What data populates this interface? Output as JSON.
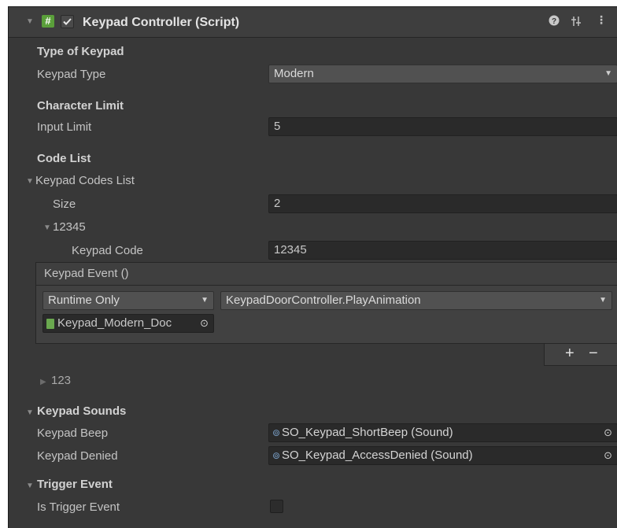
{
  "component": {
    "title": "Keypad Controller (Script)",
    "enabled": true
  },
  "sections": {
    "type_of_keypad": "Type of Keypad",
    "character_limit": "Character Limit",
    "code_list": "Code List"
  },
  "fields": {
    "keypad_type_label": "Keypad Type",
    "keypad_type_value": "Modern",
    "input_limit_label": "Input Limit",
    "input_limit_value": "5",
    "codes_list_label": "Keypad Codes List",
    "size_label": "Size",
    "size_value": "2",
    "element0_label": "12345",
    "keypad_code_label": "Keypad Code",
    "keypad_code_value": "12345",
    "element1_label": "123"
  },
  "event": {
    "title": "Keypad Event ()",
    "runtime_value": "Runtime Only",
    "function_value": "KeypadDoorController.PlayAnimation",
    "object_value": "Keypad_Modern_Doc",
    "add_label": "+",
    "remove_label": "−"
  },
  "sounds": {
    "title": "Keypad Sounds",
    "beep_label": "Keypad Beep",
    "beep_value": "SO_Keypad_ShortBeep (Sound)",
    "denied_label": "Keypad Denied",
    "denied_value": "SO_Keypad_AccessDenied (Sound)"
  },
  "trigger": {
    "title": "Trigger Event",
    "is_trigger_label": "Is Trigger Event",
    "is_trigger_checked": false
  },
  "icons": {
    "script": "hash-script-icon",
    "help": "help-icon",
    "presets": "presets-sliders-icon",
    "menu": "kebab-menu-icon",
    "picker": "object-picker-icon"
  }
}
